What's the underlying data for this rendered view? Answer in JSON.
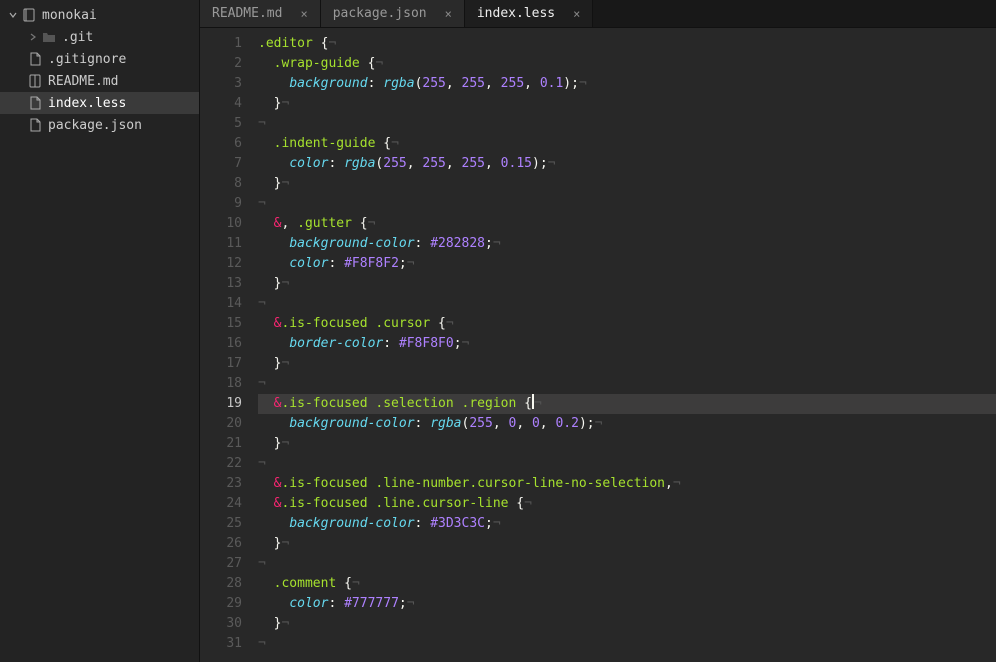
{
  "sidebar": {
    "root": {
      "name": "monokai",
      "expanded": true
    },
    "items": [
      {
        "name": ".git",
        "type": "folder",
        "expanded": false
      },
      {
        "name": ".gitignore",
        "type": "file",
        "icon": "file"
      },
      {
        "name": "README.md",
        "type": "file",
        "icon": "book"
      },
      {
        "name": "index.less",
        "type": "file",
        "icon": "file",
        "selected": true
      },
      {
        "name": "package.json",
        "type": "file",
        "icon": "file"
      }
    ]
  },
  "tabs": [
    {
      "label": "README.md",
      "active": false
    },
    {
      "label": "package.json",
      "active": false
    },
    {
      "label": "index.less",
      "active": true
    }
  ],
  "editor": {
    "current_line": 19,
    "lines": [
      [
        {
          "t": "sel",
          "v": ".editor"
        },
        {
          "t": "plain",
          "v": " "
        },
        {
          "t": "punc",
          "v": "{"
        },
        {
          "t": "invis",
          "v": "¬"
        }
      ],
      [
        {
          "t": "plain",
          "v": "  "
        },
        {
          "t": "sel",
          "v": ".wrap-guide"
        },
        {
          "t": "plain",
          "v": " "
        },
        {
          "t": "punc",
          "v": "{"
        },
        {
          "t": "invis",
          "v": "¬"
        }
      ],
      [
        {
          "t": "plain",
          "v": "    "
        },
        {
          "t": "prop",
          "v": "background"
        },
        {
          "t": "punc",
          "v": ": "
        },
        {
          "t": "prop",
          "v": "rgba"
        },
        {
          "t": "punc",
          "v": "("
        },
        {
          "t": "num",
          "v": "255"
        },
        {
          "t": "punc",
          "v": ", "
        },
        {
          "t": "num",
          "v": "255"
        },
        {
          "t": "punc",
          "v": ", "
        },
        {
          "t": "num",
          "v": "255"
        },
        {
          "t": "punc",
          "v": ", "
        },
        {
          "t": "num",
          "v": "0.1"
        },
        {
          "t": "punc",
          "v": ")"
        },
        {
          "t": "punc",
          "v": ";"
        },
        {
          "t": "invis",
          "v": "¬"
        }
      ],
      [
        {
          "t": "plain",
          "v": "  "
        },
        {
          "t": "punc",
          "v": "}"
        },
        {
          "t": "invis",
          "v": "¬"
        }
      ],
      [
        {
          "t": "invis",
          "v": "¬"
        }
      ],
      [
        {
          "t": "plain",
          "v": "  "
        },
        {
          "t": "sel",
          "v": ".indent-guide"
        },
        {
          "t": "plain",
          "v": " "
        },
        {
          "t": "punc",
          "v": "{"
        },
        {
          "t": "invis",
          "v": "¬"
        }
      ],
      [
        {
          "t": "plain",
          "v": "    "
        },
        {
          "t": "prop",
          "v": "color"
        },
        {
          "t": "punc",
          "v": ": "
        },
        {
          "t": "prop",
          "v": "rgba"
        },
        {
          "t": "punc",
          "v": "("
        },
        {
          "t": "num",
          "v": "255"
        },
        {
          "t": "punc",
          "v": ", "
        },
        {
          "t": "num",
          "v": "255"
        },
        {
          "t": "punc",
          "v": ", "
        },
        {
          "t": "num",
          "v": "255"
        },
        {
          "t": "punc",
          "v": ", "
        },
        {
          "t": "num",
          "v": "0.15"
        },
        {
          "t": "punc",
          "v": ")"
        },
        {
          "t": "punc",
          "v": ";"
        },
        {
          "t": "invis",
          "v": "¬"
        }
      ],
      [
        {
          "t": "plain",
          "v": "  "
        },
        {
          "t": "punc",
          "v": "}"
        },
        {
          "t": "invis",
          "v": "¬"
        }
      ],
      [
        {
          "t": "invis",
          "v": "¬"
        }
      ],
      [
        {
          "t": "plain",
          "v": "  "
        },
        {
          "t": "op",
          "v": "&"
        },
        {
          "t": "punc",
          "v": ", "
        },
        {
          "t": "sel",
          "v": ".gutter"
        },
        {
          "t": "plain",
          "v": " "
        },
        {
          "t": "punc",
          "v": "{"
        },
        {
          "t": "invis",
          "v": "¬"
        }
      ],
      [
        {
          "t": "plain",
          "v": "    "
        },
        {
          "t": "prop",
          "v": "background-color"
        },
        {
          "t": "punc",
          "v": ": "
        },
        {
          "t": "hex",
          "v": "#282828"
        },
        {
          "t": "punc",
          "v": ";"
        },
        {
          "t": "invis",
          "v": "¬"
        }
      ],
      [
        {
          "t": "plain",
          "v": "    "
        },
        {
          "t": "prop",
          "v": "color"
        },
        {
          "t": "punc",
          "v": ": "
        },
        {
          "t": "hex",
          "v": "#F8F8F2"
        },
        {
          "t": "punc",
          "v": ";"
        },
        {
          "t": "invis",
          "v": "¬"
        }
      ],
      [
        {
          "t": "plain",
          "v": "  "
        },
        {
          "t": "punc",
          "v": "}"
        },
        {
          "t": "invis",
          "v": "¬"
        }
      ],
      [
        {
          "t": "invis",
          "v": "¬"
        }
      ],
      [
        {
          "t": "plain",
          "v": "  "
        },
        {
          "t": "op",
          "v": "&"
        },
        {
          "t": "sel",
          "v": ".is-focused"
        },
        {
          "t": "plain",
          "v": " "
        },
        {
          "t": "sel",
          "v": ".cursor"
        },
        {
          "t": "plain",
          "v": " "
        },
        {
          "t": "punc",
          "v": "{"
        },
        {
          "t": "invis",
          "v": "¬"
        }
      ],
      [
        {
          "t": "plain",
          "v": "    "
        },
        {
          "t": "prop",
          "v": "border-color"
        },
        {
          "t": "punc",
          "v": ": "
        },
        {
          "t": "hex",
          "v": "#F8F8F0"
        },
        {
          "t": "punc",
          "v": ";"
        },
        {
          "t": "invis",
          "v": "¬"
        }
      ],
      [
        {
          "t": "plain",
          "v": "  "
        },
        {
          "t": "punc",
          "v": "}"
        },
        {
          "t": "invis",
          "v": "¬"
        }
      ],
      [
        {
          "t": "invis",
          "v": "¬"
        }
      ],
      [
        {
          "t": "plain",
          "v": "  "
        },
        {
          "t": "op",
          "v": "&"
        },
        {
          "t": "sel",
          "v": ".is-focused"
        },
        {
          "t": "plain",
          "v": " "
        },
        {
          "t": "sel",
          "v": ".selection"
        },
        {
          "t": "plain",
          "v": " "
        },
        {
          "t": "sel",
          "v": ".region"
        },
        {
          "t": "plain",
          "v": " "
        },
        {
          "t": "punc",
          "v": "{"
        },
        {
          "t": "cursor",
          "v": ""
        },
        {
          "t": "invis",
          "v": "¬"
        }
      ],
      [
        {
          "t": "plain",
          "v": "    "
        },
        {
          "t": "prop",
          "v": "background-color"
        },
        {
          "t": "punc",
          "v": ": "
        },
        {
          "t": "prop",
          "v": "rgba"
        },
        {
          "t": "punc",
          "v": "("
        },
        {
          "t": "num",
          "v": "255"
        },
        {
          "t": "punc",
          "v": ", "
        },
        {
          "t": "num",
          "v": "0"
        },
        {
          "t": "punc",
          "v": ", "
        },
        {
          "t": "num",
          "v": "0"
        },
        {
          "t": "punc",
          "v": ", "
        },
        {
          "t": "num",
          "v": "0.2"
        },
        {
          "t": "punc",
          "v": ")"
        },
        {
          "t": "punc",
          "v": ";"
        },
        {
          "t": "invis",
          "v": "¬"
        }
      ],
      [
        {
          "t": "plain",
          "v": "  "
        },
        {
          "t": "punc",
          "v": "}"
        },
        {
          "t": "invis",
          "v": "¬"
        }
      ],
      [
        {
          "t": "invis",
          "v": "¬"
        }
      ],
      [
        {
          "t": "plain",
          "v": "  "
        },
        {
          "t": "op",
          "v": "&"
        },
        {
          "t": "sel",
          "v": ".is-focused"
        },
        {
          "t": "plain",
          "v": " "
        },
        {
          "t": "sel",
          "v": ".line-number"
        },
        {
          "t": "sel",
          "v": ".cursor-line-no-selection"
        },
        {
          "t": "punc",
          "v": ","
        },
        {
          "t": "invis",
          "v": "¬"
        }
      ],
      [
        {
          "t": "plain",
          "v": "  "
        },
        {
          "t": "op",
          "v": "&"
        },
        {
          "t": "sel",
          "v": ".is-focused"
        },
        {
          "t": "plain",
          "v": " "
        },
        {
          "t": "sel",
          "v": ".line"
        },
        {
          "t": "sel",
          "v": ".cursor-line"
        },
        {
          "t": "plain",
          "v": " "
        },
        {
          "t": "punc",
          "v": "{"
        },
        {
          "t": "invis",
          "v": "¬"
        }
      ],
      [
        {
          "t": "plain",
          "v": "    "
        },
        {
          "t": "prop",
          "v": "background-color"
        },
        {
          "t": "punc",
          "v": ": "
        },
        {
          "t": "hex",
          "v": "#3D3C3C"
        },
        {
          "t": "punc",
          "v": ";"
        },
        {
          "t": "invis",
          "v": "¬"
        }
      ],
      [
        {
          "t": "plain",
          "v": "  "
        },
        {
          "t": "punc",
          "v": "}"
        },
        {
          "t": "invis",
          "v": "¬"
        }
      ],
      [
        {
          "t": "invis",
          "v": "¬"
        }
      ],
      [
        {
          "t": "plain",
          "v": "  "
        },
        {
          "t": "sel",
          "v": ".comment"
        },
        {
          "t": "plain",
          "v": " "
        },
        {
          "t": "punc",
          "v": "{"
        },
        {
          "t": "invis",
          "v": "¬"
        }
      ],
      [
        {
          "t": "plain",
          "v": "    "
        },
        {
          "t": "prop",
          "v": "color"
        },
        {
          "t": "punc",
          "v": ": "
        },
        {
          "t": "hex",
          "v": "#777777"
        },
        {
          "t": "punc",
          "v": ";"
        },
        {
          "t": "invis",
          "v": "¬"
        }
      ],
      [
        {
          "t": "plain",
          "v": "  "
        },
        {
          "t": "punc",
          "v": "}"
        },
        {
          "t": "invis",
          "v": "¬"
        }
      ],
      [
        {
          "t": "invis",
          "v": "¬"
        }
      ]
    ]
  }
}
